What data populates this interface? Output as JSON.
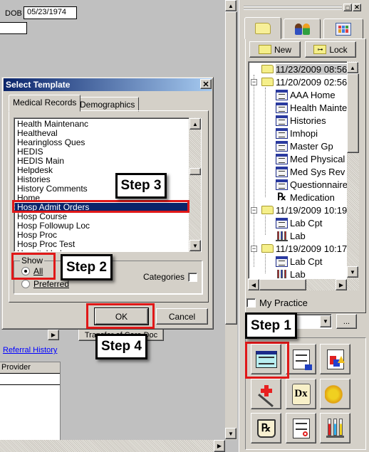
{
  "main": {
    "dob_label": "DOB",
    "dob_value": "05/23/1974",
    "transfer_button": "Transfer of Care Doc",
    "referral_link": "Referral History",
    "provider_header": "Provider"
  },
  "right_panel": {
    "tabs": [
      {
        "icon": "folder-icon"
      },
      {
        "icon": "people-icon"
      },
      {
        "icon": "calendar-folder-icon"
      }
    ],
    "new_button": "New",
    "lock_button": "Lock",
    "tree": [
      {
        "type": "folder",
        "label": "11/23/2009 08:56",
        "level": 0,
        "selected": true
      },
      {
        "type": "folder",
        "label": "11/20/2009 02:56",
        "level": 0,
        "expanded": true
      },
      {
        "type": "doc",
        "label": "AAA Home",
        "level": 1
      },
      {
        "type": "doc",
        "label": "Health Maintenance",
        "level": 1
      },
      {
        "type": "doc",
        "label": "Histories",
        "level": 1
      },
      {
        "type": "doc",
        "label": "Imhopi",
        "level": 1
      },
      {
        "type": "doc",
        "label": "Master Gp",
        "level": 1
      },
      {
        "type": "doc",
        "label": "Med Physical",
        "level": 1
      },
      {
        "type": "doc",
        "label": "Med Sys Rev",
        "level": 1
      },
      {
        "type": "doc",
        "label": "Questionnaire",
        "level": 1
      },
      {
        "type": "rx",
        "label": "Medication",
        "level": 1
      },
      {
        "type": "folder",
        "label": "11/19/2009 10:19",
        "level": 0,
        "expanded": true
      },
      {
        "type": "doc",
        "label": "Lab Cpt",
        "level": 1
      },
      {
        "type": "lab",
        "label": "Lab",
        "level": 1
      },
      {
        "type": "folder",
        "label": "11/19/2009 10:17",
        "level": 0,
        "expanded": true
      },
      {
        "type": "doc",
        "label": "Lab Cpt",
        "level": 1
      },
      {
        "type": "lab",
        "label": "Lab",
        "level": 1
      }
    ],
    "my_practice_label": "My Practice",
    "my_practice_checked": false,
    "practice_combo_value": "",
    "ellipsis_button": "...",
    "tools": [
      "templates-icon",
      "document-sign-icon",
      "report-icon",
      "immunization-icon",
      "diagnosis-scroll-icon",
      "allergy-icon",
      "prescription-icon",
      "order-form-icon",
      "lab-tubes-icon"
    ]
  },
  "dialog": {
    "title": "Select Template",
    "tabs": [
      "Medical Records",
      "Demographics"
    ],
    "active_tab": "Medical Records",
    "templates": [
      "Health Maintenanc",
      "Healtheval",
      "Hearingloss Ques",
      "HEDIS",
      "HEDIS Main",
      "Helpdesk",
      "Histories",
      "History Comments",
      "Home",
      "Hosp Admit Orders",
      "Hosp Course",
      "Hosp Followup Loc",
      "Hosp Proc",
      "Hosp Proc Test",
      "Hospital Labs"
    ],
    "selected_template": "Hosp Admit Orders",
    "show_legend": "Show",
    "show_options": [
      "All",
      "Preferred"
    ],
    "show_selected": "All",
    "categories_label": "Categories",
    "categories_checked": false,
    "ok_button": "OK",
    "cancel_button": "Cancel"
  },
  "annotations": {
    "step1": "Step 1",
    "step2": "Step 2",
    "step3": "Step 3",
    "step4": "Step 4",
    "highlight_color": "#e01818"
  }
}
